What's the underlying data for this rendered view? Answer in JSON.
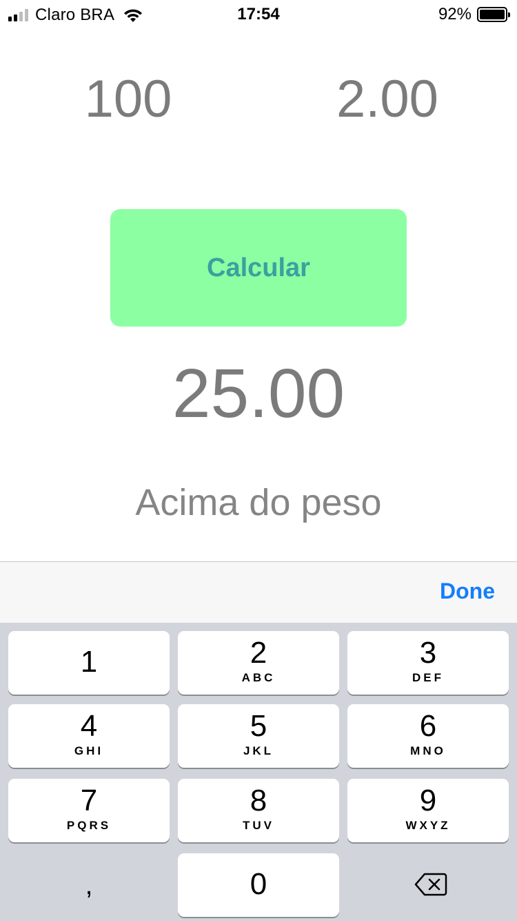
{
  "status_bar": {
    "carrier": "Claro BRA",
    "time": "17:54",
    "battery_percent": "92%"
  },
  "inputs": {
    "weight": "100",
    "height": "2.00"
  },
  "calculate_button": {
    "label": "Calcular"
  },
  "result": {
    "value": "25.00",
    "classification": "Acima do peso"
  },
  "keyboard": {
    "done_label": "Done",
    "keys": [
      {
        "num": "1",
        "letters": ""
      },
      {
        "num": "2",
        "letters": "ABC"
      },
      {
        "num": "3",
        "letters": "DEF"
      },
      {
        "num": "4",
        "letters": "GHI"
      },
      {
        "num": "5",
        "letters": "JKL"
      },
      {
        "num": "6",
        "letters": "MNO"
      },
      {
        "num": "7",
        "letters": "PQRS"
      },
      {
        "num": "8",
        "letters": "TUV"
      },
      {
        "num": "9",
        "letters": "WXYZ"
      },
      {
        "num": "0",
        "letters": ""
      }
    ],
    "decimal_key": ",",
    "delete_icon": "delete-backspace-icon"
  },
  "colors": {
    "button_bg": "#8bffa2",
    "button_text": "#3ba09f",
    "value_text": "#7b7b7b",
    "done_text": "#147efb",
    "keyboard_bg": "#d1d5db"
  }
}
